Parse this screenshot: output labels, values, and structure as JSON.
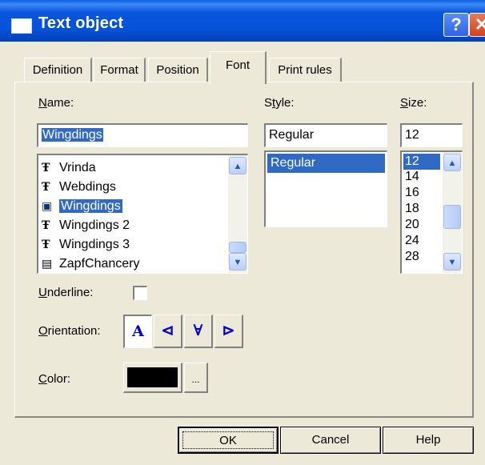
{
  "window": {
    "title": "Text object",
    "help_glyph": "?",
    "close_glyph": "✕"
  },
  "tabs": [
    {
      "label": "Definition"
    },
    {
      "label": "Format"
    },
    {
      "label": "Position"
    },
    {
      "label": "Font",
      "active": true
    },
    {
      "label": "Print rules"
    }
  ],
  "font": {
    "name_label_u": "N",
    "name_label_rest": "ame:",
    "name_value": "Wingdings",
    "list": [
      {
        "label": "Vrinda",
        "icon": "truetype-icon"
      },
      {
        "label": "Webdings",
        "icon": "truetype-icon"
      },
      {
        "label": "Wingdings",
        "icon": "printer-font-icon",
        "selected": true
      },
      {
        "label": "Wingdings 2",
        "icon": "truetype-icon"
      },
      {
        "label": "Wingdings 3",
        "icon": "truetype-icon"
      },
      {
        "label": "ZapfChancery",
        "icon": "printer-font-icon"
      }
    ]
  },
  "style": {
    "label_pre": "S",
    "label_u": "t",
    "label_rest": "yle:",
    "value": "Regular",
    "list": [
      {
        "label": "Regular",
        "selected": true
      }
    ]
  },
  "size": {
    "label_u": "S",
    "label_rest": "ize:",
    "value": "12",
    "list": [
      "12",
      "14",
      "16",
      "18",
      "20",
      "24",
      "28"
    ],
    "selected": "12"
  },
  "underline": {
    "label_u": "U",
    "label_rest": "nderline:",
    "checked": false
  },
  "orientation": {
    "label_u": "O",
    "label_rest": "rientation:",
    "buttons": [
      {
        "glyph": "A",
        "name": "orientation-normal-button",
        "pressed": true
      },
      {
        "glyph": "⊲",
        "name": "orientation-left-button"
      },
      {
        "glyph": "∀",
        "name": "orientation-upside-down-button"
      },
      {
        "glyph": "⊳",
        "name": "orientation-right-button"
      }
    ]
  },
  "color": {
    "label_u": "C",
    "label_rest": "olor:",
    "value": "#000000",
    "more_label": "..."
  },
  "buttons": {
    "ok": "OK",
    "cancel": "Cancel",
    "help": "Help"
  },
  "colors": {
    "titlebar": "#0653d8",
    "selection": "#316ac5",
    "face": "#ece9d8"
  }
}
